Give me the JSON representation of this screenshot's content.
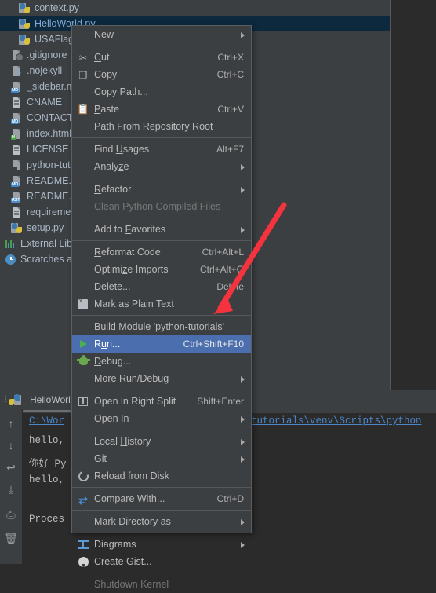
{
  "app": {
    "theme_bg": "#2b2b2b",
    "panel_bg": "#3c3f41",
    "accent_selection": "#4b6eaf",
    "tree_selection": "#0d293e",
    "link_color": "#4a86c8",
    "annotation_color": "#f5333f"
  },
  "project_tree": {
    "items": [
      {
        "label": "context.py",
        "icon": "python-file-icon",
        "indent": 18,
        "selected": false
      },
      {
        "label": "HelloWorld.py",
        "icon": "python-file-icon",
        "indent": 18,
        "selected": true
      },
      {
        "label": "USAFlag.py",
        "icon": "python-file-icon",
        "indent": 18,
        "selected": false
      },
      {
        "label": ".gitignore",
        "icon": "gitignore-file-icon",
        "indent": 8,
        "selected": false
      },
      {
        "label": ".nojekyll",
        "icon": "unknown-file-icon",
        "indent": 8,
        "selected": false
      },
      {
        "label": "_sidebar.md",
        "icon": "markdown-file-icon",
        "indent": 8,
        "selected": false
      },
      {
        "label": "CNAME",
        "icon": "text-file-icon",
        "indent": 8,
        "selected": false
      },
      {
        "label": "CONTACT.md",
        "icon": "markdown-file-icon",
        "indent": 8,
        "selected": false
      },
      {
        "label": "index.html",
        "icon": "html-file-icon",
        "indent": 8,
        "selected": false
      },
      {
        "label": "LICENSE",
        "icon": "text-file-icon",
        "indent": 8,
        "selected": false
      },
      {
        "label": "python-tutorials",
        "icon": "terminal-file-icon",
        "indent": 8,
        "selected": false
      },
      {
        "label": "README.md",
        "icon": "markdown-file-icon",
        "indent": 8,
        "selected": false
      },
      {
        "label": "README.rst",
        "icon": "rst-file-icon",
        "indent": 8,
        "selected": false
      },
      {
        "label": "requirements.txt",
        "icon": "text-file-icon",
        "indent": 8,
        "selected": false
      },
      {
        "label": "setup.py",
        "icon": "python-file-icon",
        "indent": 8,
        "selected": false
      },
      {
        "label": "External Libraries",
        "icon": "library-icon",
        "indent": 0,
        "selected": false
      },
      {
        "label": "Scratches and Consoles",
        "icon": "clock-icon",
        "indent": 0,
        "selected": false
      }
    ]
  },
  "context_menu": {
    "items": [
      {
        "label": "New",
        "mnemonic": "",
        "shortcut": "",
        "icon": "",
        "submenu": true,
        "disabled": false,
        "highlighted": false
      },
      {
        "separator": true
      },
      {
        "label": "Cut",
        "mnemonic": "C",
        "shortcut": "Ctrl+X",
        "icon": "cut-icon",
        "submenu": false,
        "disabled": false,
        "highlighted": false
      },
      {
        "label": "Copy",
        "mnemonic": "C",
        "shortcut": "Ctrl+C",
        "icon": "copy-icon",
        "submenu": false,
        "disabled": false,
        "highlighted": false
      },
      {
        "label": "Copy Path...",
        "mnemonic": "",
        "shortcut": "",
        "icon": "",
        "submenu": false,
        "disabled": false,
        "highlighted": false
      },
      {
        "label": "Paste",
        "mnemonic": "P",
        "shortcut": "Ctrl+V",
        "icon": "paste-icon",
        "submenu": false,
        "disabled": false,
        "highlighted": false
      },
      {
        "label": "Path From Repository Root",
        "mnemonic": "",
        "shortcut": "",
        "icon": "",
        "submenu": false,
        "disabled": false,
        "highlighted": false
      },
      {
        "separator": true
      },
      {
        "label": "Find Usages",
        "mnemonic": "U",
        "shortcut": "Alt+F7",
        "icon": "",
        "submenu": false,
        "disabled": false,
        "highlighted": false
      },
      {
        "label": "Analyze",
        "mnemonic": "z",
        "shortcut": "",
        "icon": "",
        "submenu": true,
        "disabled": false,
        "highlighted": false
      },
      {
        "separator": true
      },
      {
        "label": "Refactor",
        "mnemonic": "R",
        "shortcut": "",
        "icon": "",
        "submenu": true,
        "disabled": false,
        "highlighted": false
      },
      {
        "label": "Clean Python Compiled Files",
        "mnemonic": "",
        "shortcut": "",
        "icon": "",
        "submenu": false,
        "disabled": true,
        "highlighted": false
      },
      {
        "separator": true
      },
      {
        "label": "Add to Favorites",
        "mnemonic": "F",
        "shortcut": "",
        "icon": "",
        "submenu": true,
        "disabled": false,
        "highlighted": false
      },
      {
        "separator": true
      },
      {
        "label": "Reformat Code",
        "mnemonic": "R",
        "shortcut": "Ctrl+Alt+L",
        "icon": "",
        "submenu": false,
        "disabled": false,
        "highlighted": false
      },
      {
        "label": "Optimize Imports",
        "mnemonic": "z",
        "shortcut": "Ctrl+Alt+O",
        "icon": "",
        "submenu": false,
        "disabled": false,
        "highlighted": false
      },
      {
        "label": "Delete...",
        "mnemonic": "D",
        "shortcut": "Delete",
        "icon": "",
        "submenu": false,
        "disabled": false,
        "highlighted": false
      },
      {
        "label": "Mark as Plain Text",
        "mnemonic": "",
        "shortcut": "",
        "icon": "plain-text-icon",
        "submenu": false,
        "disabled": false,
        "highlighted": false
      },
      {
        "separator": true
      },
      {
        "label": "Build Module 'python-tutorials'",
        "mnemonic": "M",
        "shortcut": "",
        "icon": "",
        "submenu": false,
        "disabled": false,
        "highlighted": false
      },
      {
        "label": "Run...",
        "mnemonic": "u",
        "shortcut": "Ctrl+Shift+F10",
        "icon": "run-icon",
        "submenu": false,
        "disabled": false,
        "highlighted": true
      },
      {
        "label": "Debug...",
        "mnemonic": "D",
        "shortcut": "",
        "icon": "debug-icon",
        "submenu": false,
        "disabled": false,
        "highlighted": false
      },
      {
        "label": "More Run/Debug",
        "mnemonic": "",
        "shortcut": "",
        "icon": "",
        "submenu": true,
        "disabled": false,
        "highlighted": false
      },
      {
        "separator": true
      },
      {
        "label": "Open in Right Split",
        "mnemonic": "",
        "shortcut": "Shift+Enter",
        "icon": "split-icon",
        "submenu": false,
        "disabled": false,
        "highlighted": false
      },
      {
        "label": "Open In",
        "mnemonic": "",
        "shortcut": "",
        "icon": "",
        "submenu": true,
        "disabled": false,
        "highlighted": false
      },
      {
        "separator": true
      },
      {
        "label": "Local History",
        "mnemonic": "H",
        "shortcut": "",
        "icon": "",
        "submenu": true,
        "disabled": false,
        "highlighted": false
      },
      {
        "label": "Git",
        "mnemonic": "G",
        "shortcut": "",
        "icon": "",
        "submenu": true,
        "disabled": false,
        "highlighted": false
      },
      {
        "label": "Reload from Disk",
        "mnemonic": "",
        "shortcut": "",
        "icon": "reload-icon",
        "submenu": false,
        "disabled": false,
        "highlighted": false
      },
      {
        "separator": true
      },
      {
        "label": "Compare With...",
        "mnemonic": "",
        "shortcut": "Ctrl+D",
        "icon": "compare-icon",
        "submenu": false,
        "disabled": false,
        "highlighted": false
      },
      {
        "separator": true
      },
      {
        "label": "Mark Directory as",
        "mnemonic": "",
        "shortcut": "",
        "icon": "",
        "submenu": true,
        "disabled": false,
        "highlighted": false
      },
      {
        "separator": true
      },
      {
        "label": "Diagrams",
        "mnemonic": "",
        "shortcut": "",
        "icon": "diagram-icon",
        "submenu": true,
        "disabled": false,
        "highlighted": false
      },
      {
        "label": "Create Gist...",
        "mnemonic": "",
        "shortcut": "",
        "icon": "github-icon",
        "submenu": false,
        "disabled": false,
        "highlighted": false
      },
      {
        "separator": true
      },
      {
        "label": "Shutdown Kernel",
        "mnemonic": "",
        "shortcut": "",
        "icon": "",
        "submenu": false,
        "disabled": true,
        "highlighted": false
      }
    ]
  },
  "run_panel": {
    "tab_label": "HelloWorld",
    "tab_icon": "python-file-icon",
    "toolbar": [
      {
        "name": "up-arrow-icon",
        "glyph": "↑"
      },
      {
        "name": "down-arrow-icon",
        "glyph": "↓"
      },
      {
        "name": "soft-wrap-icon",
        "glyph": "↩"
      },
      {
        "name": "scroll-to-end-icon",
        "glyph": "⤓"
      },
      {
        "name": "print-icon",
        "glyph": "⎙"
      },
      {
        "name": "trash-icon",
        "glyph": "🗑"
      }
    ],
    "output": [
      {
        "text": "C:\\Wor",
        "type": "path-left",
        "tail": "tutorials\\venv\\Scripts\\python"
      },
      {
        "text": "hello,",
        "type": "plain"
      },
      {
        "text": "你好 Py",
        "type": "plain"
      },
      {
        "text": "hello,",
        "type": "plain"
      },
      {
        "text": "",
        "type": "plain"
      },
      {
        "text": "Proces",
        "type": "plain"
      }
    ]
  },
  "annotation": {
    "type": "arrow",
    "color": "#f5333f",
    "points_to": "Run..."
  }
}
